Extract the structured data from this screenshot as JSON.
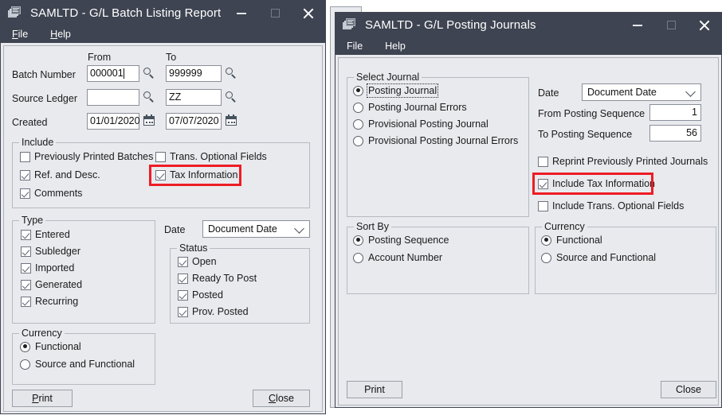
{
  "background_window": {
    "visible": true
  },
  "left_window": {
    "title": "SAMLTD - G/L Batch Listing Report",
    "icon": "stacked-documents-icon",
    "window_controls": {
      "minimize": "–",
      "maximize": "□",
      "close": "✕"
    },
    "menu": [
      {
        "label": "File",
        "accel": "F"
      },
      {
        "label": "Help",
        "accel": "H"
      }
    ],
    "column_headers": {
      "from": "From",
      "to": "To"
    },
    "fields": [
      {
        "label": "Batch Number",
        "from": "000001",
        "to": "999999",
        "picker": "magnifier-icon"
      },
      {
        "label": "Source Ledger",
        "from": "",
        "to": "ZZ",
        "picker": "magnifier-icon"
      },
      {
        "label": "Created",
        "from": "01/01/2020",
        "to": "07/07/2020",
        "picker": "calendar-icon"
      }
    ],
    "include_group": {
      "title": "Include",
      "items": [
        {
          "label": "Previously Printed Batches",
          "checked": false
        },
        {
          "label": "Trans. Optional Fields",
          "checked": false
        },
        {
          "label": "Ref. and Desc.",
          "checked": true
        },
        {
          "label": "Tax Information",
          "checked": true,
          "highlighted": true
        },
        {
          "label": "Comments",
          "checked": true
        }
      ]
    },
    "type_group": {
      "title": "Type",
      "items": [
        {
          "label": "Entered",
          "checked": true
        },
        {
          "label": "Subledger",
          "checked": true
        },
        {
          "label": "Imported",
          "checked": true
        },
        {
          "label": "Generated",
          "checked": true
        },
        {
          "label": "Recurring",
          "checked": true
        }
      ]
    },
    "date_selector": {
      "label": "Date",
      "value": "Document Date"
    },
    "status_group": {
      "title": "Status",
      "items": [
        {
          "label": "Open",
          "checked": true
        },
        {
          "label": "Ready To Post",
          "checked": true
        },
        {
          "label": "Posted",
          "checked": true
        },
        {
          "label": "Prov. Posted",
          "checked": true
        }
      ]
    },
    "currency_group": {
      "title": "Currency",
      "items": [
        {
          "label": "Functional",
          "selected": true
        },
        {
          "label": "Source and Functional",
          "selected": false
        }
      ]
    },
    "buttons": {
      "print": "Print",
      "close": "Close"
    }
  },
  "right_window": {
    "title": "SAMLTD - G/L Posting Journals",
    "icon": "stacked-documents-icon",
    "window_controls": {
      "minimize": "–",
      "maximize": "□",
      "close": "✕"
    },
    "menu": [
      {
        "label": "File"
      },
      {
        "label": "Help"
      }
    ],
    "select_journal_group": {
      "title": "Select Journal",
      "items": [
        {
          "label": "Posting Journal",
          "selected": true,
          "focused": true
        },
        {
          "label": "Posting Journal Errors",
          "selected": false
        },
        {
          "label": "Provisional Posting Journal",
          "selected": false
        },
        {
          "label": "Provisional Posting Journal Errors",
          "selected": false
        }
      ]
    },
    "date_selector": {
      "label": "Date",
      "value": "Document Date"
    },
    "sequence_fields": [
      {
        "label": "From Posting Sequence",
        "value": "1"
      },
      {
        "label": "To Posting Sequence",
        "value": "56"
      }
    ],
    "options": [
      {
        "label": "Reprint Previously Printed Journals",
        "checked": false
      },
      {
        "label": "Include Tax Information",
        "checked": true,
        "highlighted": true
      },
      {
        "label": "Include Trans. Optional Fields",
        "checked": false
      }
    ],
    "sort_by_group": {
      "title": "Sort By",
      "items": [
        {
          "label": "Posting Sequence",
          "selected": true
        },
        {
          "label": "Account Number",
          "selected": false
        }
      ]
    },
    "currency_group": {
      "title": "Currency",
      "items": [
        {
          "label": "Functional",
          "selected": true
        },
        {
          "label": "Source and Functional",
          "selected": false
        }
      ]
    },
    "buttons": {
      "print": "Print",
      "close": "Close"
    }
  },
  "colors": {
    "titlebar": "#3e4451",
    "window_face": "#e9eaee",
    "highlight_red": "#ee1c25",
    "field_border": "#8a8f98",
    "group_border": "#b6bac1"
  }
}
